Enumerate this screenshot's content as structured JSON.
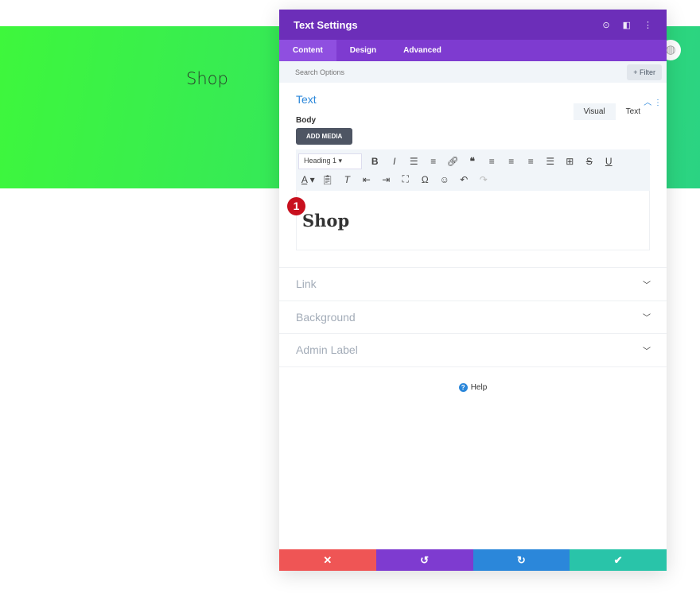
{
  "banner": {
    "text": "Shop"
  },
  "modal": {
    "title": "Text Settings",
    "tabs": [
      "Content",
      "Design",
      "Advanced"
    ],
    "search_placeholder": "Search Options",
    "filter_label": "+ Filter",
    "text_section": {
      "title": "Text",
      "body_label": "Body",
      "add_media": "ADD MEDIA",
      "visual_tab": "Visual",
      "text_tab": "Text",
      "format_select": "Heading 1",
      "content": "Shop"
    },
    "badge": "1",
    "sections": [
      "Link",
      "Background",
      "Admin Label"
    ],
    "help": "Help"
  },
  "colors": {
    "header": "#6c2eb9",
    "tabs": "#7e3bd0",
    "cancel": "#ef5555",
    "undo": "#7e3bd0",
    "redo": "#2b87da",
    "save": "#29c4a9"
  }
}
